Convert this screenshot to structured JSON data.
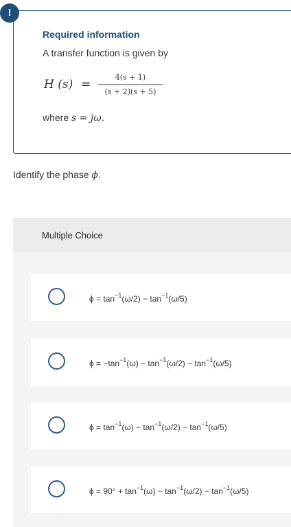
{
  "info": {
    "badge": "!",
    "title": "Required information",
    "intro": "A transfer function is given by",
    "formula": {
      "lhs": "H (s)",
      "eq": "=",
      "numerator": "4(s + 1)",
      "denominator": "(s + 2)(s + 5)"
    },
    "where_prefix": "where ",
    "where_expr": "s = jω."
  },
  "question": {
    "text": "Identify the phase ",
    "symbol": "ϕ",
    "suffix": "."
  },
  "multiple_choice": {
    "header": "Multiple Choice",
    "options": [
      {
        "parts": [
          "ϕ = tan",
          "−1",
          "(ω/2) − tan",
          "−1",
          "(ω/5)"
        ]
      },
      {
        "parts": [
          "ϕ = −tan",
          "−1",
          "(ω) − tan",
          "−1",
          "(ω/2) − tan",
          "−1",
          "(ω/5)"
        ]
      },
      {
        "parts": [
          "ϕ = tan",
          "−1",
          "(ω) − tan",
          "−1",
          "(ω/2) − tan",
          "−1",
          "(ω/5)"
        ]
      },
      {
        "parts": [
          "ϕ = 90° + tan",
          "−1",
          "(ω) − tan",
          "−1",
          "(ω/2) − tan",
          "−1",
          "(ω/5)"
        ]
      }
    ]
  },
  "colors": {
    "accent": "#1f4e79",
    "radio_border": "#2c5e91",
    "panel_bg": "#f4f4f4",
    "header_bg": "#ececec"
  }
}
